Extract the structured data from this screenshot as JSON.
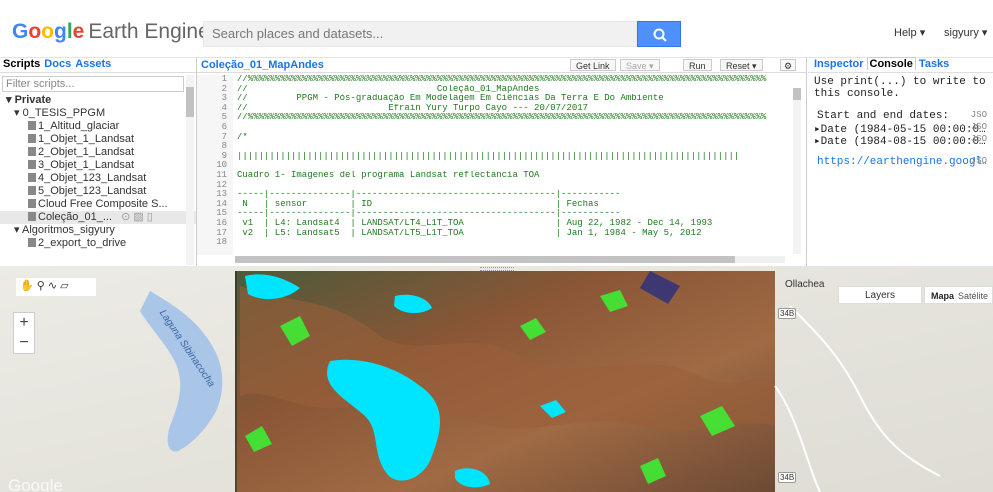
{
  "header": {
    "logo_google": [
      "G",
      "o",
      "o",
      "g",
      "l",
      "e"
    ],
    "logo_product": "Earth Engine",
    "search_placeholder": "Search places and datasets...",
    "help_label": "Help",
    "user_label": "sigyury"
  },
  "left_panel": {
    "tabs": [
      "Scripts",
      "Docs",
      "Assets"
    ],
    "active_tab": "Scripts",
    "filter_placeholder": "Filter scripts...",
    "tree": [
      {
        "label": "Private",
        "type": "folder"
      },
      {
        "label": "0_TESIS_PPGM",
        "type": "folder"
      },
      {
        "label": "1_Altitud_glaciar",
        "type": "file"
      },
      {
        "label": "1_Objet_1_Landsat",
        "type": "file"
      },
      {
        "label": "2_Objet_1_Landsat",
        "type": "file"
      },
      {
        "label": "3_Objet_1_Landsat",
        "type": "file"
      },
      {
        "label": "4_Objet_123_Landsat",
        "type": "file"
      },
      {
        "label": "5_Objet_123_Landsat",
        "type": "file"
      },
      {
        "label": "Cloud Free Composite S...",
        "type": "file"
      },
      {
        "label": "Coleção_01_...",
        "type": "file"
      },
      {
        "label": "Algoritmos_sigyury",
        "type": "folder"
      },
      {
        "label": "2_export_to_drive",
        "type": "file"
      }
    ]
  },
  "editor": {
    "script_title": "Coleção_01_MapAndes",
    "buttons": {
      "get_link": "Get Link",
      "save": "Save",
      "run": "Run",
      "reset": "Reset"
    },
    "line_numbers": [
      "1",
      "2",
      "3",
      "4",
      "5",
      "6",
      "7",
      "8",
      "9",
      "10",
      "11",
      "12",
      "13",
      "14",
      "15",
      "16",
      "17",
      "18"
    ],
    "lines": [
      "//%%%%%%%%%%%%%%%%%%%%%%%%%%%%%%%%%%%%%%%%%%%%%%%%%%%%%%%%%%%%%%%%%%%%%%%%%%%%%%%%%%%%%%%%%%%%%%%%",
      "//                                   Coleção_01_MapAndes",
      "//         PPGM - Pós-graduação Em Modelagem Em Ciências Da Terra E Do Ambiente",
      "//                          Efrain Yury Turpo Cayo --- 20/07/2017",
      "//%%%%%%%%%%%%%%%%%%%%%%%%%%%%%%%%%%%%%%%%%%%%%%%%%%%%%%%%%%%%%%%%%%%%%%%%%%%%%%%%%%%%%%%%%%%%%%%%",
      "",
      "/*",
      "",
      "|||||||||||||||||||||||||||||||||||||||||||||||||||||||||||||||||||||||||||||||||||||||||||||",
      "",
      "Cuadro 1- Imagenes del programa Landsat reflectancia TOA",
      "",
      "-----|---------------|-------------------------------------|-----------",
      " N   | sensor        | ID                                  | Fechas",
      "-----|---------------|-------------------------------------|-----------",
      " v1  | L4: Landsat4  | LANDSAT/LT4_L1T_TOA                 | Aug 22, 1982 - Dec 14, 1993",
      " v2  | L5: Landsat5  | LANDSAT/LT5_L1T_TOA                 | Jan 1, 1984 - May 5, 2012",
      ""
    ]
  },
  "right_panel": {
    "tabs": [
      "Inspector",
      "Console",
      "Tasks"
    ],
    "active_tab": "Console",
    "console_hint": [
      "Use print(...) to write to",
      "this console."
    ],
    "entries": [
      {
        "text": "Start and end dates:",
        "tag": "JSO"
      },
      {
        "text": "▸Date (1984-05-15 00:00:0…",
        "tag": "JSO"
      },
      {
        "text": "▸Date (1984-08-15 00:00:0…",
        "tag": "JSO"
      },
      {
        "text": "https://earthengine.googl…",
        "tag": "JSO"
      }
    ]
  },
  "map": {
    "layers_label": "Layers",
    "map_type_selected": "Mapa",
    "map_type_other": "Satélite",
    "place_label": "Ollachea",
    "lake_label": "Laguna Sibinacocha",
    "road_label": "34B",
    "google_mark": "Google",
    "zoom_in": "+",
    "zoom_out": "−",
    "tools": "✋ ⚲ ∿ ▱"
  },
  "colors": {
    "accent": "#1a73e8",
    "water": "#00e5ff",
    "vegetation": "#33ff33",
    "terrain": "#8a5a3a"
  }
}
